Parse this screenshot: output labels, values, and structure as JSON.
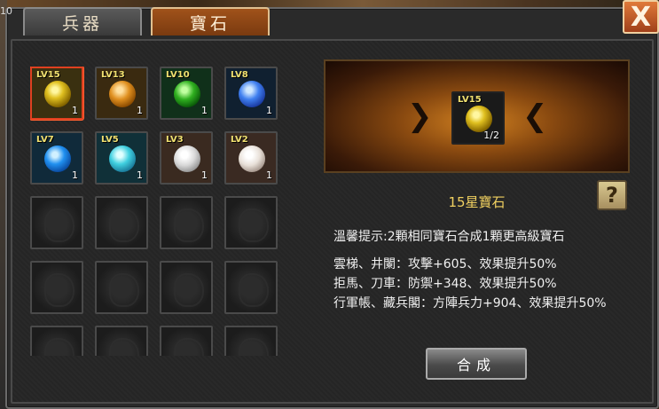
{
  "top_corner_number": "10",
  "tabs": [
    {
      "label": "兵器",
      "active": false
    },
    {
      "label": "寶石",
      "active": true
    }
  ],
  "close_label": "X",
  "gems": [
    {
      "level": "LV15",
      "count": "1",
      "color": "yellow",
      "selected": true
    },
    {
      "level": "LV13",
      "count": "1",
      "color": "orange",
      "selected": false
    },
    {
      "level": "LV10",
      "count": "1",
      "color": "green",
      "selected": false
    },
    {
      "level": "LV8",
      "count": "1",
      "color": "blue",
      "selected": false
    },
    {
      "level": "LV7",
      "count": "1",
      "color": "blue-cube",
      "selected": false
    },
    {
      "level": "LV5",
      "count": "1",
      "color": "cyan",
      "selected": false
    },
    {
      "level": "LV3",
      "count": "1",
      "color": "white",
      "selected": false
    },
    {
      "level": "LV2",
      "count": "1",
      "color": "white-pearl",
      "selected": false
    }
  ],
  "empty_slot_count": 12,
  "preview": {
    "level": "LV15",
    "count": "1/2"
  },
  "gem_name": "15星寶石",
  "help_label": "?",
  "tip": "溫馨提示:2顆相同寶石合成1顆更高級寶石",
  "effects": [
    "雲梯、井闌：攻擊+605、效果提升50%",
    "拒馬、刀車：防禦+348、效果提升50%",
    "行軍帳、藏兵閣：方陣兵力+904、效果提升50%"
  ],
  "compose_label": "合成",
  "colors": {
    "accent": "#f0d060",
    "selected_border": "#e04020",
    "tab_active": "#a0521a"
  }
}
